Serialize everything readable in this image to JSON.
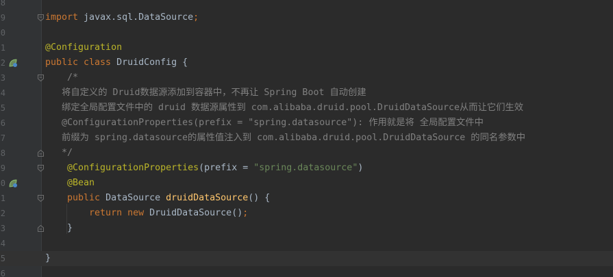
{
  "editor": {
    "lines": [
      {
        "num": "8",
        "parts": []
      },
      {
        "num": "9",
        "parts": [
          {
            "t": "import",
            "c": "kw"
          },
          {
            "t": " javax.sql.DataSource",
            "c": ""
          },
          {
            "t": ";",
            "c": "kw"
          }
        ]
      },
      {
        "num": "0",
        "parts": []
      },
      {
        "num": "1",
        "parts": [
          {
            "t": "@Configuration",
            "c": "ann"
          }
        ]
      },
      {
        "num": "2",
        "parts": [
          {
            "t": "public class ",
            "c": "kw"
          },
          {
            "t": "DruidConfig {",
            "c": ""
          }
        ]
      },
      {
        "num": "3",
        "parts": [
          {
            "t": "    /*",
            "c": "cmt"
          }
        ]
      },
      {
        "num": "4",
        "parts": [
          {
            "t": "   将自定义的 Druid数据源添加到容器中，不再让 Spring Boot 自动创建",
            "c": "cmt"
          }
        ]
      },
      {
        "num": "5",
        "parts": [
          {
            "t": "   绑定全局配置文件中的 druid 数据源属性到 com.alibaba.druid.pool.DruidDataSource从而让它们生效",
            "c": "cmt"
          }
        ]
      },
      {
        "num": "6",
        "parts": [
          {
            "t": "   @ConfigurationProperties(prefix = \"spring.datasource\"): 作用就是将 全局配置文件中",
            "c": "cmt"
          }
        ]
      },
      {
        "num": "7",
        "parts": [
          {
            "t": "   前缀为 spring.datasource的属性值注入到 com.alibaba.druid.pool.DruidDataSource 的同名参数中",
            "c": "cmt"
          }
        ]
      },
      {
        "num": "8",
        "parts": [
          {
            "t": "   */",
            "c": "cmt"
          }
        ]
      },
      {
        "num": "9",
        "parts": [
          {
            "t": "    @ConfigurationProperties",
            "c": "ann"
          },
          {
            "t": "(prefix = ",
            "c": ""
          },
          {
            "t": "\"spring.datasource\"",
            "c": "str"
          },
          {
            "t": ")",
            "c": ""
          }
        ]
      },
      {
        "num": "0",
        "parts": [
          {
            "t": "    @Bean",
            "c": "ann"
          }
        ]
      },
      {
        "num": "1",
        "parts": [
          {
            "t": "    public ",
            "c": "kw"
          },
          {
            "t": "DataSource ",
            "c": ""
          },
          {
            "t": "druidDataSource",
            "c": "fn"
          },
          {
            "t": "() {",
            "c": ""
          }
        ]
      },
      {
        "num": "2",
        "parts": [
          {
            "t": "        return new ",
            "c": "kw"
          },
          {
            "t": "DruidDataSource()",
            "c": ""
          },
          {
            "t": ";",
            "c": "kw"
          }
        ]
      },
      {
        "num": "3",
        "parts": [
          {
            "t": "    }",
            "c": ""
          }
        ]
      },
      {
        "num": "4",
        "parts": []
      },
      {
        "num": "5",
        "parts": [
          {
            "t": "}",
            "c": ""
          }
        ]
      },
      {
        "num": "6",
        "parts": []
      }
    ],
    "gutter_icons": [
      {
        "line_index": 4,
        "name": "spring-bean-config-icon"
      },
      {
        "line_index": 12,
        "name": "spring-bean-method-icon"
      }
    ],
    "fold_markers": [
      {
        "line_index": 1,
        "kind": "start"
      },
      {
        "line_index": 5,
        "kind": "start"
      },
      {
        "line_index": 10,
        "kind": "end"
      },
      {
        "line_index": 11,
        "kind": "start"
      },
      {
        "line_index": 13,
        "kind": "start"
      },
      {
        "line_index": 15,
        "kind": "end"
      }
    ],
    "current_line_index": 17,
    "colors": {
      "background": "#2b2b2b",
      "gutter": "#313335",
      "keyword": "#cc7832",
      "annotation": "#bbb529",
      "method": "#ffc66d",
      "string": "#6a8759",
      "comment": "#808080",
      "text": "#a9b7c6"
    }
  }
}
